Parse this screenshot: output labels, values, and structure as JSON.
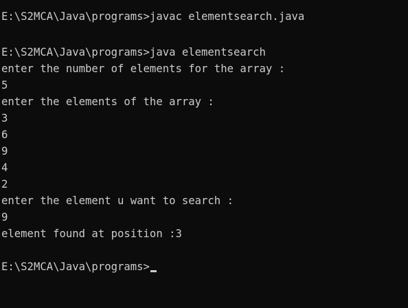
{
  "console": {
    "background": "#0c0c0c",
    "foreground": "#cccccc",
    "lines": [
      "E:\\S2MCA\\Java\\programs>javac elementsearch.java",
      "",
      "E:\\S2MCA\\Java\\programs>java elementsearch",
      "enter the number of elements for the array :",
      "5",
      "enter the elements of the array :",
      "3",
      "6",
      "9",
      "4",
      "2",
      "enter the element u want to search :",
      "9",
      "element found at position :3",
      "",
      "E:\\S2MCA\\Java\\programs>"
    ]
  }
}
